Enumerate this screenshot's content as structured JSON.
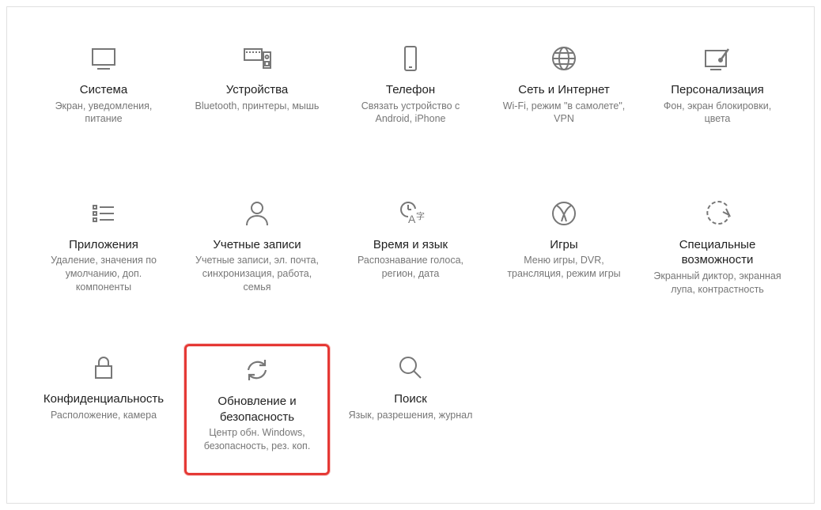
{
  "tiles": [
    {
      "id": "system",
      "title": "Система",
      "desc": "Экран, уведомления, питание",
      "highlighted": false
    },
    {
      "id": "devices",
      "title": "Устройства",
      "desc": "Bluetooth, принтеры, мышь",
      "highlighted": false
    },
    {
      "id": "phone",
      "title": "Телефон",
      "desc": "Связать устройство с Android, iPhone",
      "highlighted": false
    },
    {
      "id": "network",
      "title": "Сеть и Интернет",
      "desc": "Wi-Fi, режим \"в самолете\", VPN",
      "highlighted": false
    },
    {
      "id": "personalize",
      "title": "Персонализация",
      "desc": "Фон, экран блокировки, цвета",
      "highlighted": false
    },
    {
      "id": "apps",
      "title": "Приложения",
      "desc": "Удаление, значения по умолчанию, доп. компоненты",
      "highlighted": false
    },
    {
      "id": "accounts",
      "title": "Учетные записи",
      "desc": "Учетные записи, эл. почта, синхронизация, работа, семья",
      "highlighted": false
    },
    {
      "id": "time",
      "title": "Время и язык",
      "desc": "Распознавание голоса, регион, дата",
      "highlighted": false
    },
    {
      "id": "gaming",
      "title": "Игры",
      "desc": "Меню игры, DVR, трансляция, режим игры",
      "highlighted": false
    },
    {
      "id": "ease",
      "title": "Специальные возможности",
      "desc": "Экранный диктор, экранная лупа, контрастность",
      "highlighted": false
    },
    {
      "id": "privacy",
      "title": "Конфиденциальность",
      "desc": "Расположение, камера",
      "highlighted": false
    },
    {
      "id": "update",
      "title": "Обновление и безопасность",
      "desc": "Центр обн. Windows, безопасность, рез. коп.",
      "highlighted": true
    },
    {
      "id": "search",
      "title": "Поиск",
      "desc": "Язык, разрешения, журнал",
      "highlighted": false
    }
  ],
  "colors": {
    "icon": "#777",
    "highlight": "#e53935"
  }
}
